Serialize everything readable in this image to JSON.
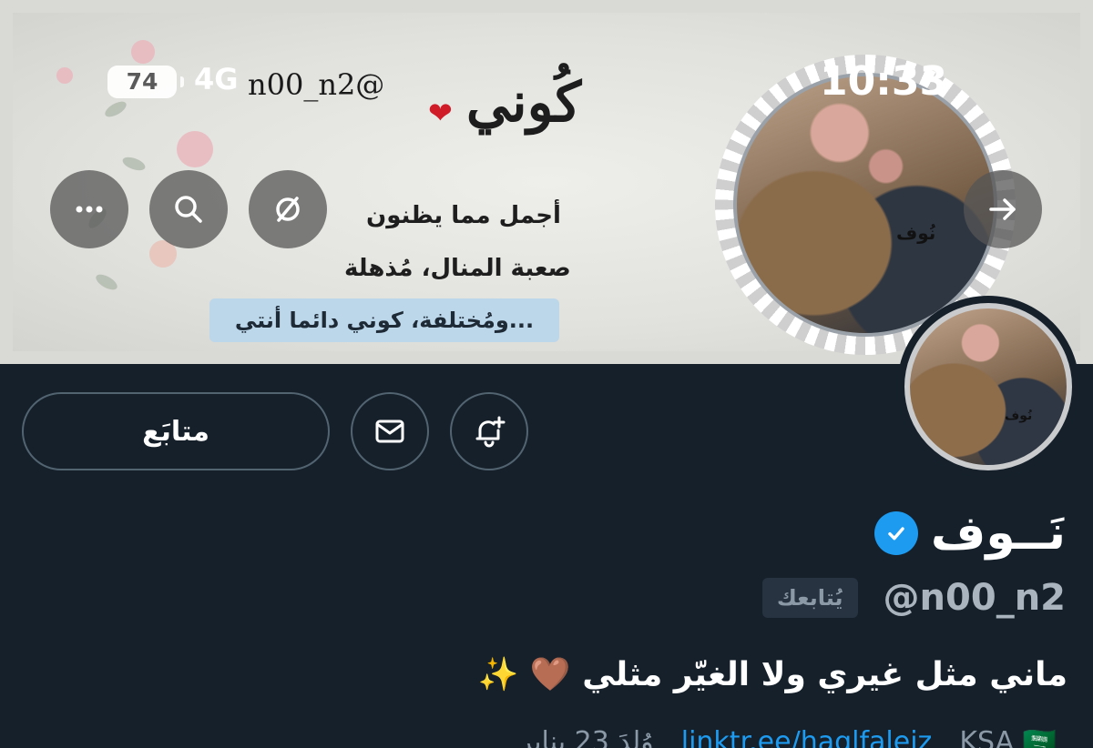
{
  "status_bar": {
    "battery": "74",
    "network": "4G",
    "time": "10:33"
  },
  "banner": {
    "handle": "n00_n2@",
    "title": "كُوني",
    "line1": "أجمل مما يظنون",
    "line2": "صعبة المنال، مُذهلة",
    "pill": "ومُختلفة، كوني دائما أنتي...",
    "portrait_tag": "نُوف"
  },
  "actions": {
    "follow_label": "متابَع"
  },
  "profile": {
    "display_name": "نَــوف",
    "handle": "@n00_n2",
    "follows_you": "يُتابعك",
    "bio": "ماني مثل غيري ولا الغيّر مثلي 🤎 ✨",
    "meta": {
      "born": "وُلِدَ 23 يناير",
      "link": "linktr.ee/haglfaleiz",
      "location": "KSA 🇸🇦"
    }
  },
  "colors": {
    "background": "#15202b",
    "accent": "#1d9bf0",
    "border": "#536471"
  }
}
